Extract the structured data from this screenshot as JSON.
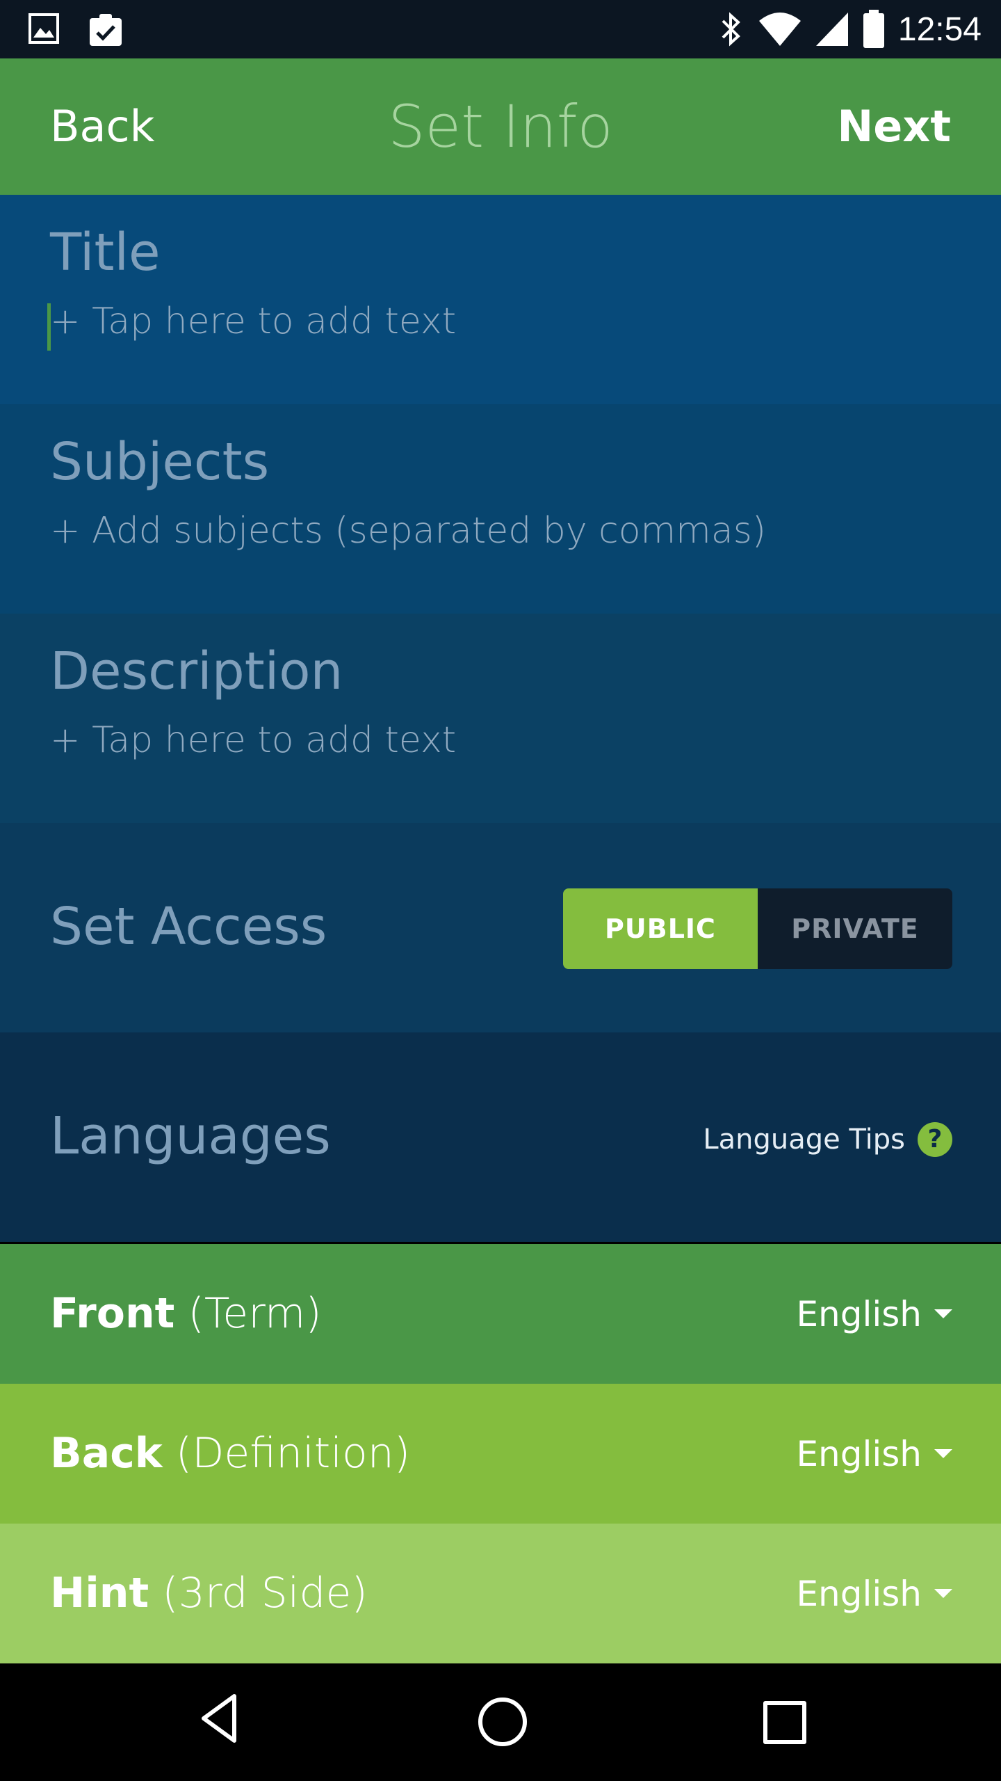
{
  "status_bar": {
    "time": "12:54",
    "icons": [
      "image-icon",
      "clipboard-check-icon",
      "bluetooth-icon",
      "wifi-icon",
      "signal-icon",
      "battery-icon"
    ]
  },
  "app_bar": {
    "back_label": "Back",
    "title": "Set Info",
    "next_label": "Next"
  },
  "fields": {
    "title": {
      "label": "Title",
      "placeholder": "+ Tap here to add text"
    },
    "subjects": {
      "label": "Subjects",
      "placeholder": "+ Add subjects (separated by commas)"
    },
    "description": {
      "label": "Description",
      "placeholder": "+ Tap here to add text"
    }
  },
  "set_access": {
    "label": "Set Access",
    "public_label": "PUBLIC",
    "private_label": "PRIVATE",
    "selected": "PUBLIC"
  },
  "languages": {
    "label": "Languages",
    "tips_label": "Language Tips",
    "rows": [
      {
        "side": "Front",
        "qualifier": "(Term)",
        "language": "English"
      },
      {
        "side": "Back",
        "qualifier": "(Definition)",
        "language": "English"
      },
      {
        "side": "Hint",
        "qualifier": "(3rd Side)",
        "language": "English"
      }
    ]
  },
  "colors": {
    "app_bar": "#4a9747",
    "title_bg": "#074a7a",
    "subjects_bg": "#07456f",
    "description_bg": "#0b4164",
    "access_bg": "#0b3b5d",
    "languages_bg": "#0a2e4c",
    "front_row": "#4a9747",
    "back_row": "#84bd3e",
    "hint_row": "#9ccd63"
  }
}
